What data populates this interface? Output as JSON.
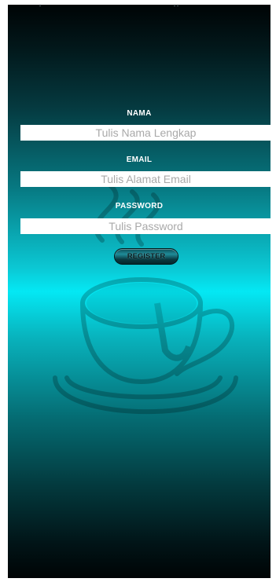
{
  "form": {
    "nama_label": "NAMA",
    "nama_placeholder": "Tulis Nama Lengkap",
    "email_label": "EMAIL",
    "email_placeholder": "Tulis Alamat Email",
    "password_label": "PASSWORD",
    "password_placeholder": "Tulis Password",
    "register_label": "REGISTER"
  },
  "background": {
    "image": "coffee-cup-icon",
    "colors": {
      "top": "#000405",
      "mid": "#04e8f4",
      "bottom": "#000405"
    }
  }
}
